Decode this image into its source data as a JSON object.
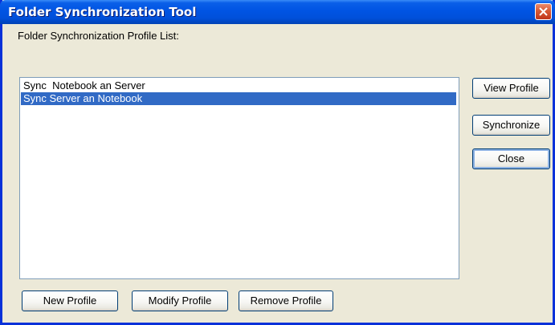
{
  "window": {
    "title": "Folder Synchronization Tool"
  },
  "list_label": "Folder Synchronization Profile List:",
  "profiles": [
    {
      "label": "Sync  Notebook an Server",
      "selected": false
    },
    {
      "label": "Sync Server an Notebook",
      "selected": true
    }
  ],
  "side_buttons": {
    "view_profile": "View Profile",
    "synchronize": "Synchronize",
    "close": "Close"
  },
  "bottom_buttons": {
    "new_profile": "New Profile",
    "modify_profile": "Modify Profile",
    "remove_profile": "Remove Profile"
  },
  "colors": {
    "title_bar": "#0054e3",
    "selection": "#316ac5",
    "dialog_background": "#ece9d8",
    "close_icon_background": "#d75a35"
  }
}
